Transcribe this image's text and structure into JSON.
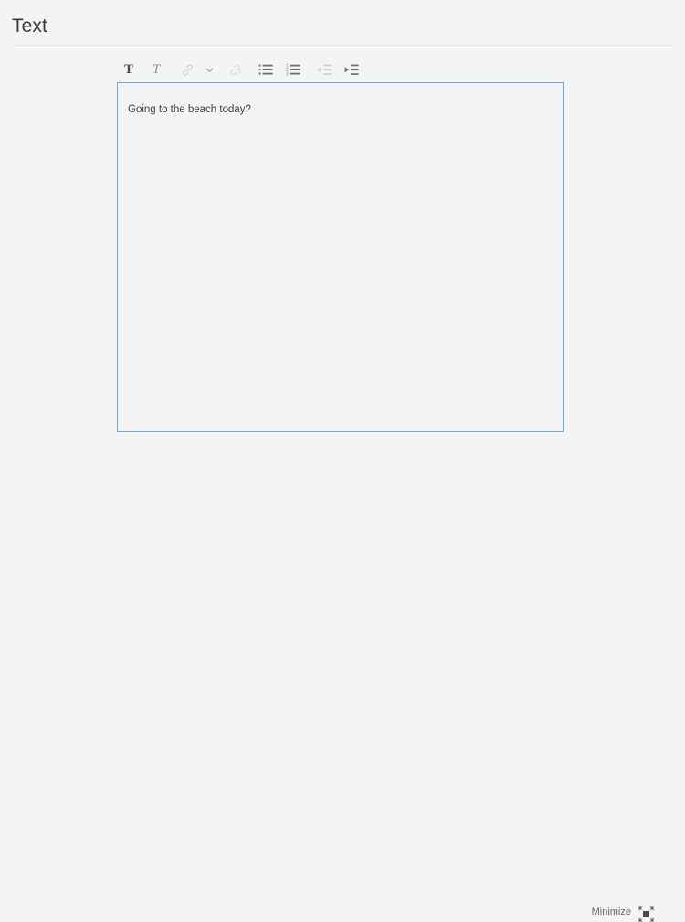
{
  "header": {
    "title": "Text"
  },
  "toolbar": {
    "items": [
      {
        "name": "bold-icon",
        "label": "T",
        "state": "enabled"
      },
      {
        "name": "italic-icon",
        "label": "T",
        "state": "enabled"
      },
      {
        "name": "link-icon",
        "label": "",
        "state": "disabled"
      },
      {
        "name": "chevron-down-icon",
        "label": "",
        "state": "enabled"
      },
      {
        "name": "unlink-icon",
        "label": "",
        "state": "disabled"
      },
      {
        "name": "bullet-list-icon",
        "label": "",
        "state": "enabled"
      },
      {
        "name": "numbered-list-icon",
        "label": "",
        "state": "enabled"
      },
      {
        "name": "outdent-icon",
        "label": "",
        "state": "disabled"
      },
      {
        "name": "indent-icon",
        "label": "",
        "state": "enabled"
      }
    ]
  },
  "editor": {
    "content": "Going to the beach today?",
    "placeholder": ""
  },
  "footer": {
    "minimize_label": "Minimize",
    "minimize_icon": "minimize-icon"
  },
  "colors": {
    "page_background": "#f4f4f4",
    "focus_border": "#7ba6dd",
    "title_text": "#3b3b3b",
    "body_text": "#3f3f3f",
    "muted_text": "#666666",
    "icon_enabled": "#737373",
    "icon_disabled": "#d2d2d2",
    "divider": "#e6e6e6"
  }
}
